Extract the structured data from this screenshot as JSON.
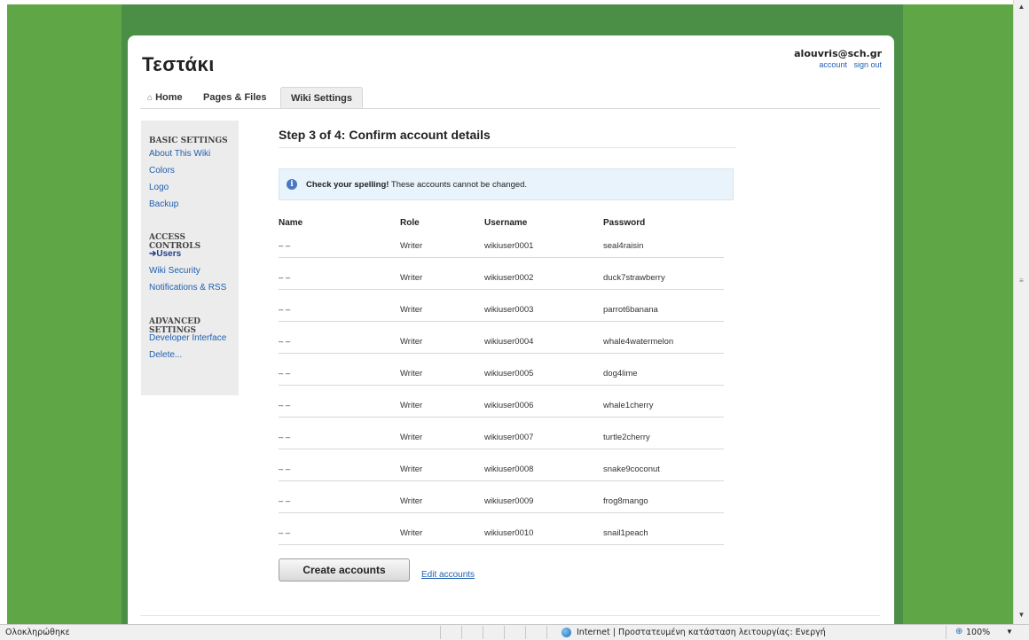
{
  "wiki": {
    "title": "Τεστάκι",
    "user_email": "alouvris@sch.gr",
    "account_link": "account",
    "signout_link": "sign out"
  },
  "tabs": {
    "home": "Home",
    "pages": "Pages & Files",
    "settings": "Wiki Settings",
    "home_icon": "home-icon"
  },
  "sidebar": {
    "basic_heading": "BASIC SETTINGS",
    "about": "About This Wiki",
    "colors": "Colors",
    "logo": "Logo",
    "backup": "Backup",
    "access_heading": "ACCESS CONTROLS",
    "users": "Users",
    "security": "Wiki Security",
    "notifications": "Notifications & RSS",
    "advanced_heading": "ADVANCED SETTINGS",
    "developer": "Developer Interface",
    "delete": "Delete..."
  },
  "main": {
    "step_title": "Step 3 of 4: Confirm account details",
    "notice_bold": "Check your spelling!",
    "notice_rest": " These accounts cannot be changed.",
    "headers": [
      "Name",
      "Role",
      "Username",
      "Password"
    ],
    "rows": [
      {
        "name": "– –",
        "role": "Writer",
        "username": "wikiuser0001",
        "password": "seal4raisin"
      },
      {
        "name": "– –",
        "role": "Writer",
        "username": "wikiuser0002",
        "password": "duck7strawberry"
      },
      {
        "name": "– –",
        "role": "Writer",
        "username": "wikiuser0003",
        "password": "parrot6banana"
      },
      {
        "name": "– –",
        "role": "Writer",
        "username": "wikiuser0004",
        "password": "whale4watermelon"
      },
      {
        "name": "– –",
        "role": "Writer",
        "username": "wikiuser0005",
        "password": "dog4lime"
      },
      {
        "name": "– –",
        "role": "Writer",
        "username": "wikiuser0006",
        "password": "whale1cherry"
      },
      {
        "name": "– –",
        "role": "Writer",
        "username": "wikiuser0007",
        "password": "turtle2cherry"
      },
      {
        "name": "– –",
        "role": "Writer",
        "username": "wikiuser0008",
        "password": "snake9coconut"
      },
      {
        "name": "– –",
        "role": "Writer",
        "username": "wikiuser0009",
        "password": "frog8mango"
      },
      {
        "name": "– –",
        "role": "Writer",
        "username": "wikiuser0010",
        "password": "snail1peach"
      }
    ],
    "create_button": "Create accounts",
    "edit_link": "Edit accounts"
  },
  "statusbar": {
    "left": "Ολοκληρώθηκε",
    "zone": "Internet | Προστατευμένη κατάσταση λειτουργίας: Ενεργή",
    "zoom": "100%"
  },
  "colors": {
    "outer_green": "#5ea646",
    "inner_green": "#4a8f45",
    "link_blue": "#1f5fb0",
    "notice_bg": "#e8f3fb"
  }
}
